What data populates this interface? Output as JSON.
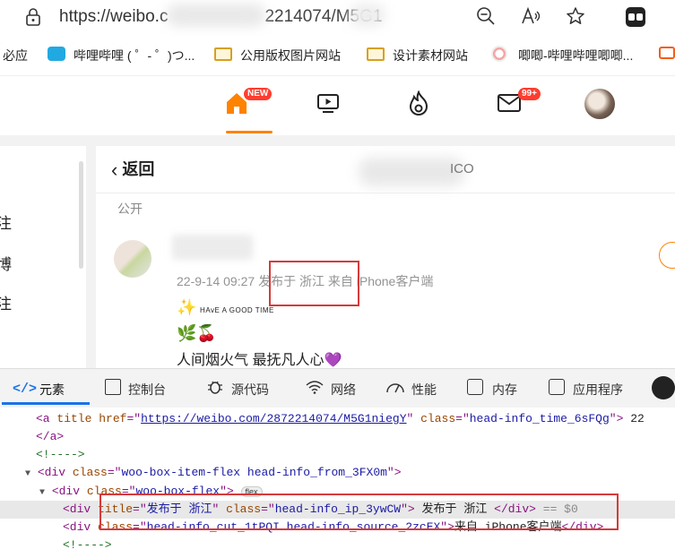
{
  "browser": {
    "url": "https://weibo.c",
    "url_tail": "2214074/M5G1",
    "bookmarks": [
      {
        "label": "必应"
      },
      {
        "label": "哔哩哔哩 ( ゜- ゜)つ..."
      },
      {
        "label": "公用版权图片网站"
      },
      {
        "label": "设计素材网站"
      },
      {
        "label": "唧唧-哔哩哔哩唧唧..."
      }
    ]
  },
  "weibo_nav": {
    "home_badge": "NEW",
    "message_badge": "99+",
    "accent_color": "#ff8200"
  },
  "left_sidebar": {
    "chars": [
      "注",
      "博",
      "注"
    ]
  },
  "post_page": {
    "back_label": "返回",
    "header_tail": "ICO",
    "visibility_label": "公开",
    "meta_time": "22-9-14 09:27",
    "meta_ip": "发布于 浙江",
    "meta_source": "来自 iPhone客户端",
    "content_line1_emoji": "✨",
    "content_line1_text": "HAvE A GOOD TIME",
    "content_line2": "🌿🍒",
    "content_line3": "人间烟火气 最抚凡人心💜"
  },
  "devtools": {
    "tabs": [
      {
        "label": "元素",
        "icon": "code-icon"
      },
      {
        "label": "控制台",
        "icon": "console-icon"
      },
      {
        "label": "源代码",
        "icon": "bug-icon"
      },
      {
        "label": "网络",
        "icon": "wifi-icon"
      },
      {
        "label": "性能",
        "icon": "gauge-icon"
      },
      {
        "label": "内存",
        "icon": "chip-icon"
      },
      {
        "label": "应用程序",
        "icon": "app-icon"
      }
    ],
    "tree": {
      "a_title_attr": "title",
      "a_href_attr": "href",
      "a_href": "https://weibo.com/2872214074/M5G1niegY",
      "a_class": "head-info_time_6sFQg",
      "a_trailing": "22",
      "close_a": "</a>",
      "comment": "<!---->",
      "div1_class": "woo-box-item-flex head-info_from_3FX0m",
      "div2_class": "woo-box-flex",
      "flex_pill": "flex",
      "sel_title": "发布于  浙江",
      "sel_class": "head-info_ip_3ywCW",
      "sel_text": "发布于  浙江 ",
      "sel_eq": "== $0",
      "div4_class": "head-info_cut_1tPQI head-info_source_2zcEX",
      "div4_text": "来自 iPhone客户端",
      "comment2": "<!---->"
    }
  }
}
